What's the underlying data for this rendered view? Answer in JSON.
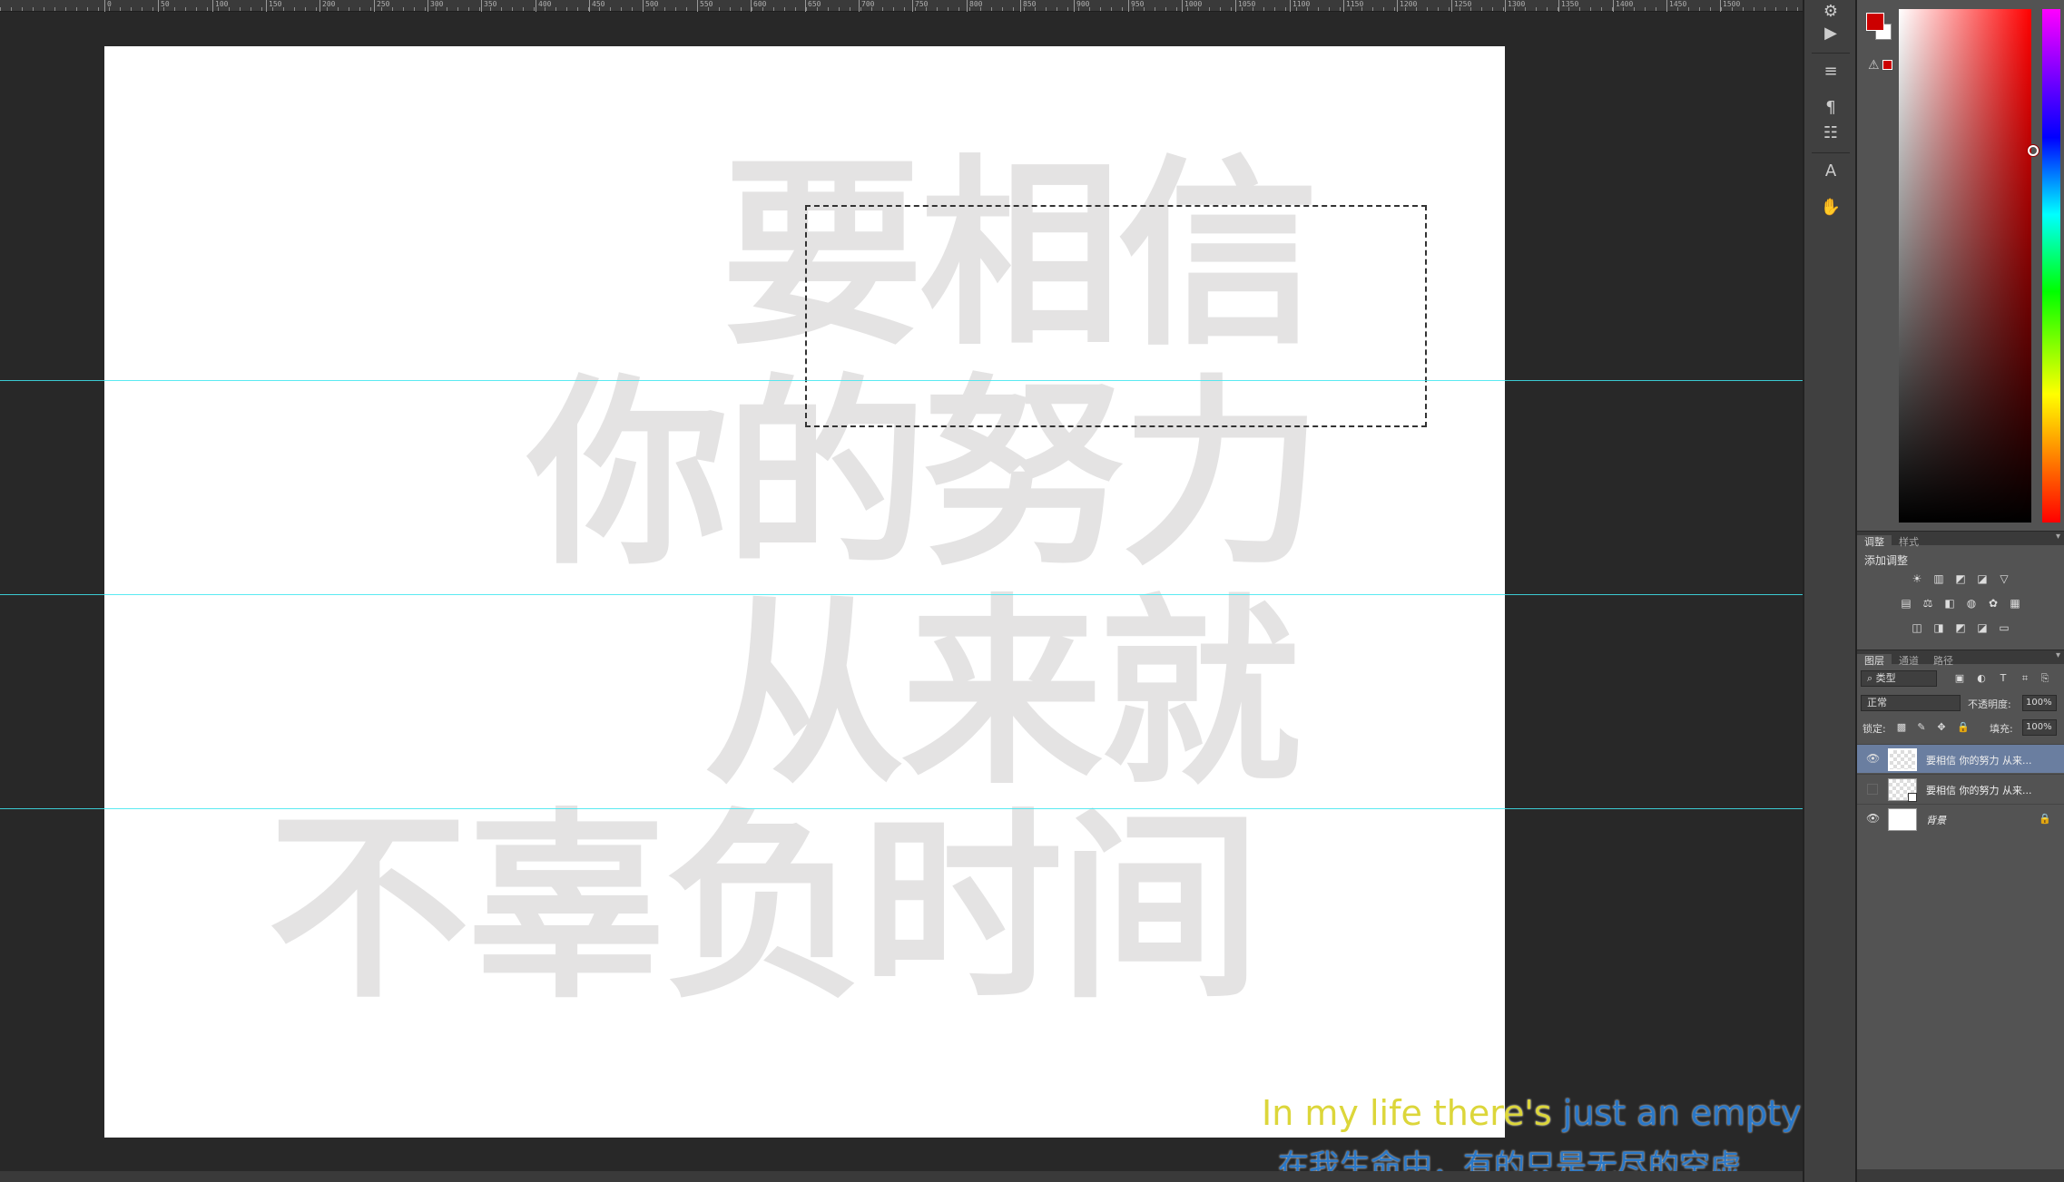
{
  "ruler": {
    "ticks": [
      "0",
      "50",
      "100",
      "150",
      "200",
      "250",
      "300",
      "350",
      "400",
      "450",
      "500",
      "550",
      "600",
      "650",
      "700",
      "750",
      "800",
      "850",
      "900",
      "950",
      "1000",
      "1050",
      "1100",
      "1150",
      "1200",
      "1250",
      "1300",
      "1350",
      "1400",
      "1450",
      "1500"
    ]
  },
  "canvas": {
    "line1": "要相信",
    "line2": "你的努力",
    "line3": "从来就",
    "line4": "不辜负时间",
    "text_color": "#e4e3e3",
    "guide_color": "#3ee6f0"
  },
  "subtitles": {
    "en_highlight": "In my life there's",
    "en_rest": " just an empty sp",
    "cn": "在我生命中，有的只是无尽的空虚"
  },
  "color_panel": {
    "foreground": "#cc0000",
    "background": "#ffffff"
  },
  "adjustments_panel": {
    "tabs": [
      "调整",
      "样式"
    ],
    "title": "添加调整"
  },
  "layers_panel": {
    "tabs": [
      "图层",
      "通道",
      "路径"
    ],
    "filter_kind": "类型",
    "blend_mode": "正常",
    "opacity_label": "不透明度:",
    "opacity_value": "100%",
    "lock_label": "锁定:",
    "fill_label": "填充:",
    "fill_value": "100%",
    "layers": [
      {
        "name": "要相信 你的努力 从来...",
        "visible": true,
        "active": true
      },
      {
        "name": "要相信 你的努力 从来...",
        "visible": false,
        "active": false
      },
      {
        "name": "背景",
        "visible": true,
        "active": false
      }
    ]
  }
}
